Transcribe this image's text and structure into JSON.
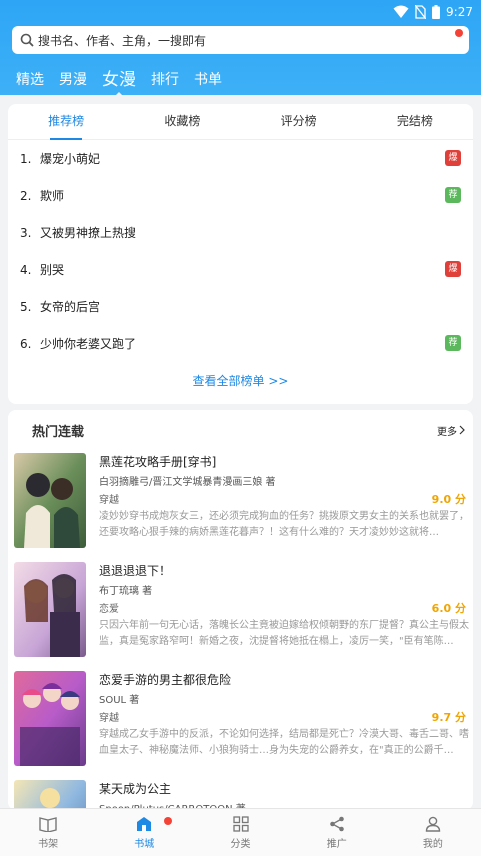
{
  "status_bar": {
    "time": "9:27"
  },
  "search": {
    "placeholder": "搜书名、作者、主角，一搜即有"
  },
  "top_tabs": [
    {
      "label": "精选"
    },
    {
      "label": "男漫"
    },
    {
      "label": "女漫",
      "active": true
    },
    {
      "label": "排行"
    },
    {
      "label": "书单"
    }
  ],
  "ranking": {
    "tabs": [
      {
        "label": "推荐榜",
        "active": true
      },
      {
        "label": "收藏榜"
      },
      {
        "label": "评分榜"
      },
      {
        "label": "完结榜"
      }
    ],
    "items": [
      {
        "num": "1.",
        "title": "爆宠小萌妃",
        "badge": "爆",
        "badge_type": "hot"
      },
      {
        "num": "2.",
        "title": "欺师",
        "badge": "荐",
        "badge_type": "rec"
      },
      {
        "num": "3.",
        "title": "又被男神撩上热搜",
        "badge": "",
        "badge_type": ""
      },
      {
        "num": "4.",
        "title": "别哭",
        "badge": "爆",
        "badge_type": "hot"
      },
      {
        "num": "5.",
        "title": "女帝的后宫",
        "badge": "",
        "badge_type": ""
      },
      {
        "num": "6.",
        "title": "少帅你老婆又跑了",
        "badge": "荐",
        "badge_type": "rec"
      }
    ],
    "view_all": "查看全部榜单 >>"
  },
  "hot_serial": {
    "title": "热门连载",
    "more": "更多",
    "books": [
      {
        "title": "黑莲花攻略手册[穿书]",
        "author": "白羽摘雕弓/晋江文学城暴青漫画三娘 著",
        "genre": "穿越",
        "score": "9.0 分",
        "desc": "凌妙妙穿书成炮灰女三，还必须完成狗血的任务？挑拨原文男女主的关系也就罢了，还要攻略心狠手辣的病娇黑莲花暮声？！这有什么难的？天才凌妙妙这就将…",
        "cover_colors": [
          "#6b8f5a",
          "#d9c9a8",
          "#3d5c3a"
        ]
      },
      {
        "title": "退退退退下！",
        "author": "布丁琉璃 著",
        "genre": "恋爱",
        "score": "6.0 分",
        "desc": "只因六年前一句无心话，落魄长公主竟被迫嫁给权倾朝野的东厂提督？真公主与假太监，真是冤家路窄呵！新婚之夜，沈提督将她抵在榻上，凌厉一笑，\"臣有笔陈…",
        "cover_colors": [
          "#c7a4d6",
          "#f3dce6",
          "#7a5a8c"
        ]
      },
      {
        "title": "恋爱手游的男主都很危险",
        "author": "SOUL 著",
        "genre": "穿越",
        "score": "9.7 分",
        "desc": "穿越成乙女手游中的反派，不论如何选择，结局都是死亡？冷漠大哥、毒舌二哥、嗜血皇太子、神秘魔法师、小狼狗骑士…身为失宠的公爵养女，在\"真正的公爵千…",
        "cover_colors": [
          "#e06a9a",
          "#b85cc9",
          "#6a3c8c"
        ]
      },
      {
        "title": "某天成为公主",
        "author": "Spoon/Plutus/CARROTOON 著",
        "genre": "",
        "score": "",
        "desc": "",
        "cover_colors": [
          "#8fb8e0",
          "#f4e6b5",
          "#4a6fa0"
        ]
      }
    ]
  },
  "bottom_nav": [
    {
      "label": "书架",
      "icon": "bookshelf-icon"
    },
    {
      "label": "书城",
      "icon": "store-icon",
      "active": true
    },
    {
      "label": "分类",
      "icon": "category-icon"
    },
    {
      "label": "推广",
      "icon": "share-icon"
    },
    {
      "label": "我的",
      "icon": "user-icon"
    }
  ],
  "colors": {
    "header": "#2ea6f5",
    "accent": "#1e88e5",
    "hot_badge": "#e0403a",
    "rec_badge": "#5cb85c",
    "score": "#f0a500"
  }
}
